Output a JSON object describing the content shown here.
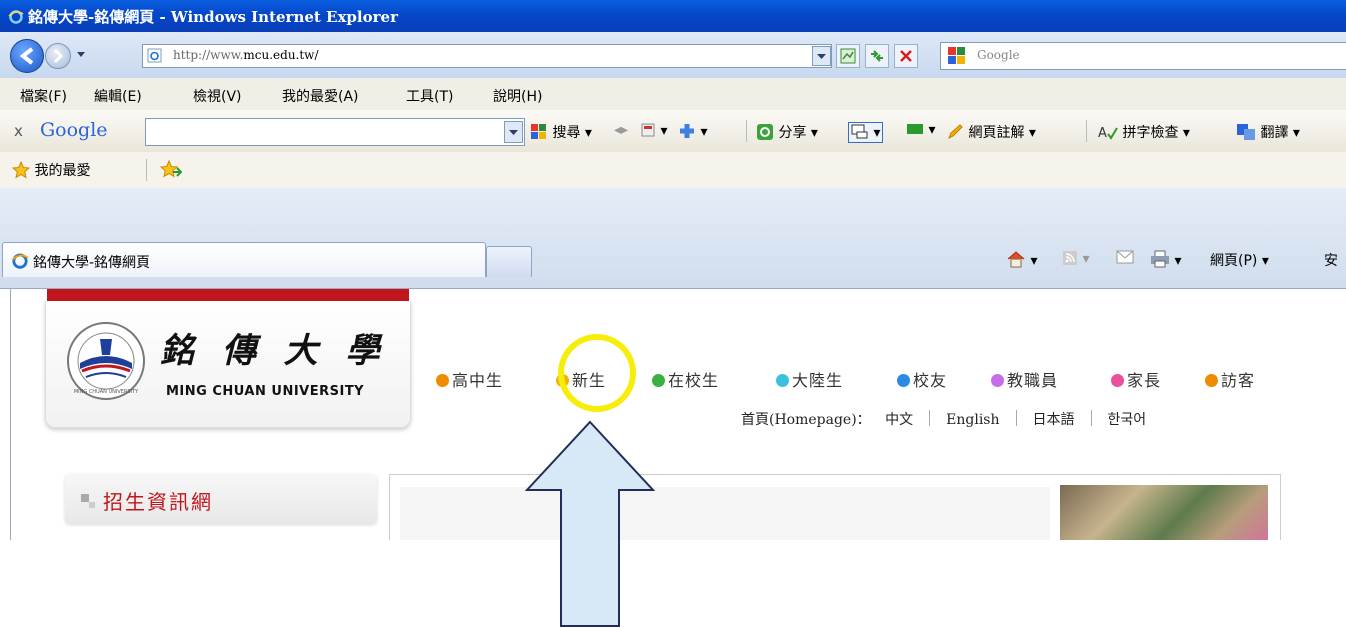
{
  "window": {
    "title": "銘傳大學-銘傳網頁 - Windows Internet Explorer"
  },
  "address_bar": {
    "url_prefix": "http://www.",
    "url_domain": "mcu.edu.tw/",
    "search_placeholder": "Google"
  },
  "menu": {
    "items": [
      "檔案(F)",
      "編輯(E)",
      "檢視(V)",
      "我的最愛(A)",
      "工具(T)",
      "說明(H)"
    ]
  },
  "google_toolbar": {
    "close": "x",
    "logo": "Google",
    "search_label": "搜尋",
    "share_label": "分享",
    "notes_label": "網頁註解",
    "spell_label": "拼字檢查",
    "translate_label": "翻譯"
  },
  "favorites_bar": {
    "favorites_label": "我的最愛"
  },
  "tabs": {
    "active_title": "銘傳大學-銘傳網頁",
    "page_menu": "網頁(P)",
    "safety_menu": "安"
  },
  "page": {
    "university_cn": "銘 傳 大 學",
    "university_en": "MING CHUAN UNIVERSITY",
    "seal_text": "MING CHUAN UNIVERSITY",
    "audiences": [
      {
        "label": "高中生",
        "color": "#f08a00"
      },
      {
        "label": "新生",
        "color": "#f0b400"
      },
      {
        "label": "在校生",
        "color": "#3cb043"
      },
      {
        "label": "大陸生",
        "color": "#3cc0e0"
      },
      {
        "label": "校友",
        "color": "#2a8ae6"
      },
      {
        "label": "教職員",
        "color": "#c46ee8"
      },
      {
        "label": "家長",
        "color": "#ec4f9c"
      },
      {
        "label": "訪客",
        "color": "#f08a00"
      }
    ],
    "homepage_label": "首頁(Homepage)：",
    "languages": [
      "中文",
      "English",
      "日本語",
      "한국어"
    ],
    "sidebar_title": "招生資訊網"
  },
  "annotation": {
    "highlight_color": "#f6ee0a",
    "arrow_color": "#d7e8f7"
  }
}
